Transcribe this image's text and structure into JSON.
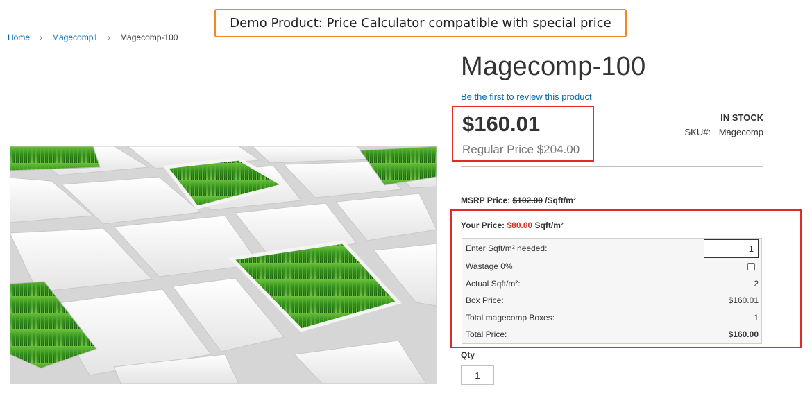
{
  "banner": {
    "text": "Demo Product: Price Calculator compatible with special price"
  },
  "breadcrumbs": {
    "items": [
      {
        "label": "Home"
      },
      {
        "label": "Magecomp1"
      },
      {
        "label": "Magecomp-100"
      }
    ],
    "separator": "›"
  },
  "product": {
    "title": "Magecomp-100",
    "review_link": "Be the first to review this product",
    "special_price": "$160.01",
    "regular_price": "Regular Price $204.00",
    "stock": "IN STOCK",
    "sku_label": "SKU#:",
    "sku_value": "Magecomp",
    "image_icon": "grass-tiles-image"
  },
  "msrp": {
    "label": "MSRP Price:",
    "old_value": "$102.00",
    "unit": "/Sqft/m²"
  },
  "calculator": {
    "your_price_label": "Your Price:",
    "your_price_value": "$80.00",
    "your_price_unit": "Sqft/m²",
    "rows": [
      {
        "label": "Enter Sqft/m² needed:",
        "value": "1"
      },
      {
        "label": "Wastage 0%",
        "value": ""
      },
      {
        "label": "Actual Sqft/m²:",
        "value": "2"
      },
      {
        "label": "Box Price:",
        "value": "$160.01"
      },
      {
        "label": "Total magecomp Boxes:",
        "value": "1"
      },
      {
        "label": "Total Price:",
        "value": "$160.00"
      }
    ]
  },
  "qty": {
    "label": "Qty",
    "value": "1"
  },
  "colors": {
    "banner_border": "#f08a1c",
    "highlight_border": "#e02b27",
    "link": "#006bb4",
    "price_accent": "#e02b27"
  }
}
